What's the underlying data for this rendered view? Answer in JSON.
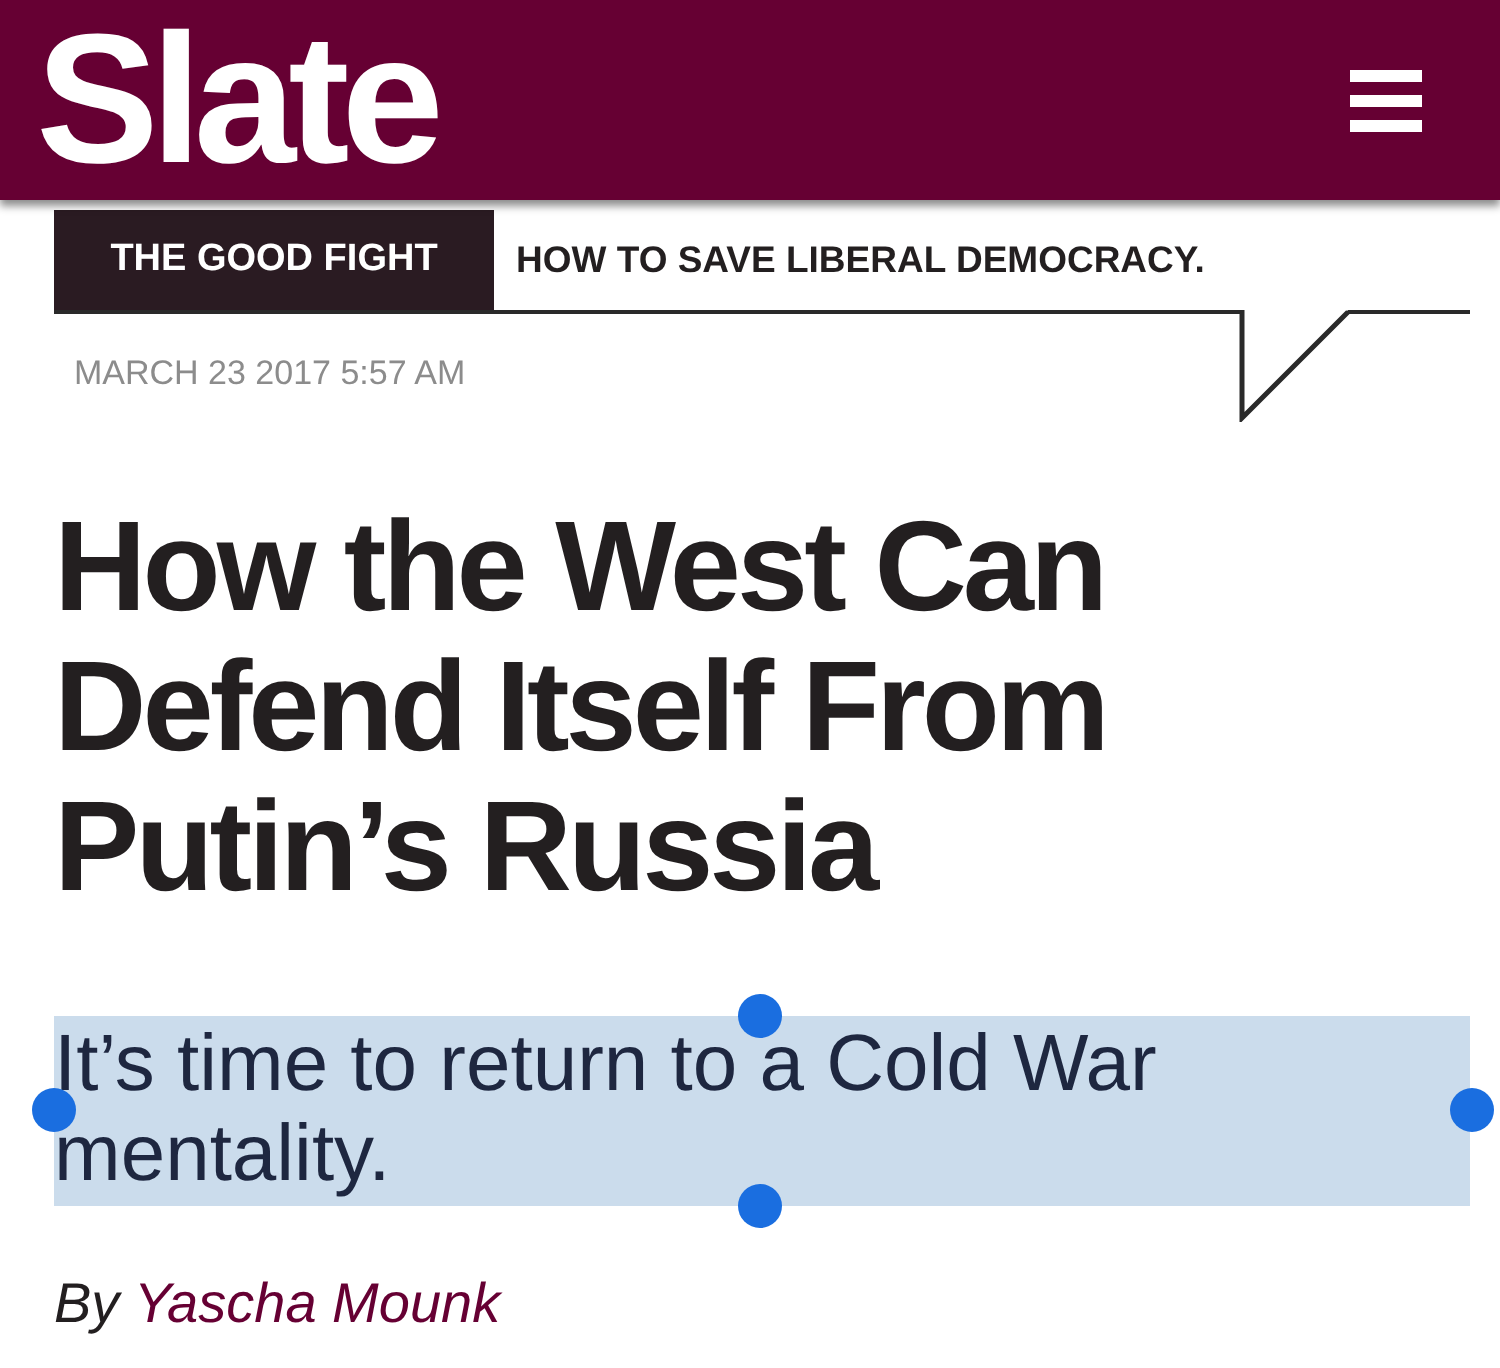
{
  "header": {
    "logo": "Slate"
  },
  "section": {
    "label": "THE GOOD FIGHT",
    "title": "HOW TO SAVE LIBERAL DEMOCRACY."
  },
  "date": "MARCH 23 2017 5:57 AM",
  "headline": "How the West Can Defend Itself From Putin’s Russia",
  "subtitle": {
    "text": "It’s time to return to a Cold War mentality.",
    "selected": true
  },
  "byline": {
    "prefix": "By",
    "author": "Yascha Mounk"
  }
}
